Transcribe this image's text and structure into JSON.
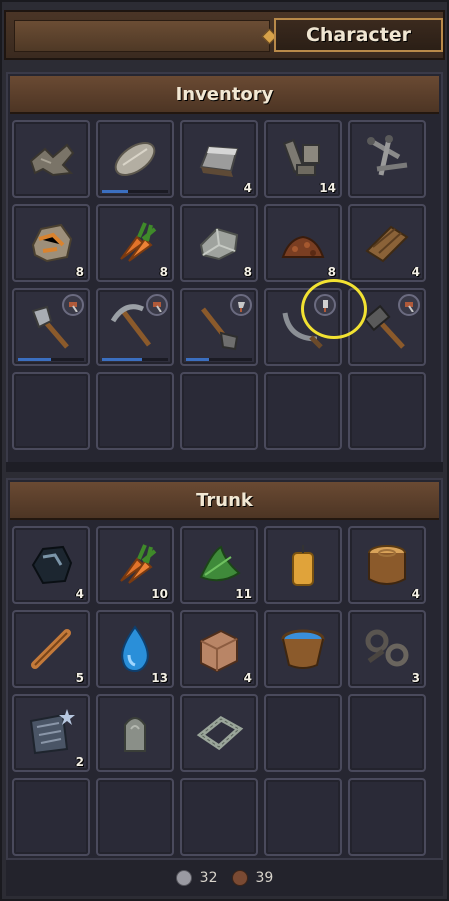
{
  "header": {
    "tab_label": "Character"
  },
  "inventory": {
    "title": "Inventory",
    "slots": [
      {
        "icon": "scrap-metal-icon",
        "count": ""
      },
      {
        "icon": "stone-slab-icon",
        "count": "",
        "durability": 0.4
      },
      {
        "icon": "iron-ingot-icon",
        "count": "4"
      },
      {
        "icon": "iron-parts-icon",
        "count": "14"
      },
      {
        "icon": "nails-icon",
        "count": ""
      },
      {
        "icon": "copper-ore-icon",
        "count": "8"
      },
      {
        "icon": "carrot-icon",
        "count": "8"
      },
      {
        "icon": "stone-block-icon",
        "count": "8"
      },
      {
        "icon": "dirt-pile-icon",
        "count": "8"
      },
      {
        "icon": "wood-planks-icon",
        "count": "4"
      },
      {
        "icon": "axe-icon",
        "count": "",
        "durability": 0.5,
        "badge": "hammer-badge-icon"
      },
      {
        "icon": "pickaxe-icon",
        "count": "",
        "durability": 0.6,
        "badge": "hammer-badge-icon"
      },
      {
        "icon": "shovel-icon",
        "count": "",
        "durability": 0.35,
        "badge": "axe-badge-icon"
      },
      {
        "icon": "sickle-icon",
        "count": "",
        "badge": "chisel-badge-icon"
      },
      {
        "icon": "hammer-icon",
        "count": "",
        "badge": "hammer-badge-icon"
      },
      {
        "icon": "",
        "count": ""
      },
      {
        "icon": "",
        "count": ""
      },
      {
        "icon": "",
        "count": ""
      },
      {
        "icon": "",
        "count": ""
      },
      {
        "icon": "",
        "count": ""
      }
    ]
  },
  "trunk": {
    "title": "Trunk",
    "slots": [
      {
        "icon": "coal-icon",
        "count": "4"
      },
      {
        "icon": "carrot-icon",
        "count": "10"
      },
      {
        "icon": "herbs-icon",
        "count": "11"
      },
      {
        "icon": "candle-icon",
        "count": ""
      },
      {
        "icon": "log-icon",
        "count": "4"
      },
      {
        "icon": "stick-icon",
        "count": "5"
      },
      {
        "icon": "water-drop-icon",
        "count": "13"
      },
      {
        "icon": "clay-icon",
        "count": "4"
      },
      {
        "icon": "water-bucket-icon",
        "count": ""
      },
      {
        "icon": "iron-scrap-icon",
        "count": "3"
      },
      {
        "icon": "scroll-icon",
        "count": "2"
      },
      {
        "icon": "gravestone-icon",
        "count": ""
      },
      {
        "icon": "frame-icon",
        "count": ""
      },
      {
        "icon": "",
        "count": ""
      },
      {
        "icon": "",
        "count": ""
      },
      {
        "icon": "",
        "count": ""
      },
      {
        "icon": "",
        "count": ""
      },
      {
        "icon": "",
        "count": ""
      },
      {
        "icon": "",
        "count": ""
      },
      {
        "icon": "",
        "count": ""
      }
    ]
  },
  "footer": {
    "silver": "32",
    "copper": "39"
  },
  "colors": {
    "silver": "#9a9aa2",
    "copper": "#7a4a33",
    "accent": "#b98a4a"
  }
}
